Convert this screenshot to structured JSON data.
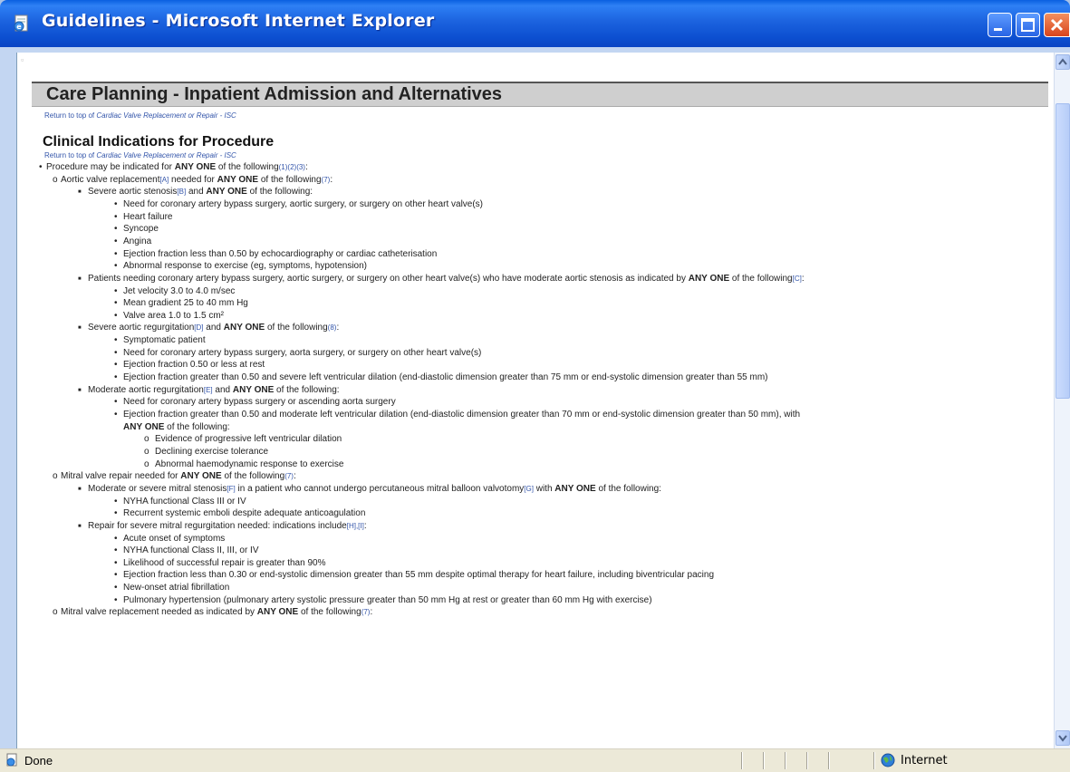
{
  "window": {
    "title": "Guidelines - Microsoft Internet Explorer"
  },
  "page": {
    "header_title": "Care Planning - Inpatient Admission and Alternatives",
    "return_link_1": {
      "prefix": "Return to top of ",
      "target": "Cardiac Valve Replacement or Repair - ISC"
    },
    "section_title": "Clinical Indications for Procedure",
    "return_link_2": {
      "prefix": "Return to top of ",
      "target": "Cardiac Valve Replacement or Repair - ISC"
    }
  },
  "content_lines": [
    {
      "level": 1,
      "parts": [
        {
          "t": "Procedure may be indicated for "
        },
        {
          "t": "ANY ONE",
          "b": true
        },
        {
          "t": " of the following"
        },
        {
          "t": "(1)(2)(3)",
          "r": true
        },
        {
          "t": ":"
        }
      ]
    },
    {
      "level": 2,
      "parts": [
        {
          "t": "Aortic valve replacement"
        },
        {
          "t": "[A]",
          "r": true
        },
        {
          "t": " needed for "
        },
        {
          "t": "ANY ONE",
          "b": true
        },
        {
          "t": " of the following"
        },
        {
          "t": "(7)",
          "r": true
        },
        {
          "t": ":"
        }
      ]
    },
    {
      "level": 3,
      "parts": [
        {
          "t": "Severe aortic stenosis"
        },
        {
          "t": "[B]",
          "r": true
        },
        {
          "t": " and "
        },
        {
          "t": "ANY ONE",
          "b": true
        },
        {
          "t": " of the following:"
        }
      ]
    },
    {
      "level": 4,
      "parts": [
        {
          "t": "Need for coronary artery bypass surgery, aortic surgery, or surgery on other heart valve(s)"
        }
      ]
    },
    {
      "level": 4,
      "parts": [
        {
          "t": "Heart failure"
        }
      ]
    },
    {
      "level": 4,
      "parts": [
        {
          "t": "Syncope"
        }
      ]
    },
    {
      "level": 4,
      "parts": [
        {
          "t": "Angina"
        }
      ]
    },
    {
      "level": 4,
      "parts": [
        {
          "t": "Ejection fraction less than 0.50 by echocardiography or cardiac catheterisation"
        }
      ]
    },
    {
      "level": 4,
      "parts": [
        {
          "t": "Abnormal response to exercise (eg, symptoms, hypotension)"
        }
      ]
    },
    {
      "level": 3,
      "parts": [
        {
          "t": "Patients needing coronary artery bypass surgery, aortic surgery, or surgery on other heart valve(s) who have moderate aortic stenosis as indicated by "
        },
        {
          "t": "ANY ONE",
          "b": true
        },
        {
          "t": " of the following"
        },
        {
          "t": "[C]",
          "r": true
        },
        {
          "t": ":"
        }
      ]
    },
    {
      "level": 4,
      "parts": [
        {
          "t": "Jet velocity 3.0 to 4.0 m/sec"
        }
      ]
    },
    {
      "level": 4,
      "parts": [
        {
          "t": "Mean gradient 25 to 40 mm Hg"
        }
      ]
    },
    {
      "level": 4,
      "parts": [
        {
          "t": "Valve area 1.0 to 1.5 cm²"
        }
      ]
    },
    {
      "level": 3,
      "parts": [
        {
          "t": "Severe aortic regurgitation"
        },
        {
          "t": "[D]",
          "r": true
        },
        {
          "t": " and "
        },
        {
          "t": "ANY ONE",
          "b": true
        },
        {
          "t": " of the following"
        },
        {
          "t": "(8)",
          "r": true
        },
        {
          "t": ":"
        }
      ]
    },
    {
      "level": 4,
      "parts": [
        {
          "t": "Symptomatic patient"
        }
      ]
    },
    {
      "level": 4,
      "parts": [
        {
          "t": "Need for coronary artery bypass surgery, aorta surgery, or surgery on other heart valve(s)"
        }
      ]
    },
    {
      "level": 4,
      "parts": [
        {
          "t": "Ejection fraction 0.50 or less at rest"
        }
      ]
    },
    {
      "level": 4,
      "parts": [
        {
          "t": "Ejection fraction greater than 0.50 and severe left ventricular dilation (end-diastolic dimension greater than 75 mm or end-systolic dimension greater than 55 mm)"
        }
      ]
    },
    {
      "level": 3,
      "parts": [
        {
          "t": "Moderate aortic regurgitation"
        },
        {
          "t": "[E]",
          "r": true
        },
        {
          "t": " and "
        },
        {
          "t": "ANY ONE",
          "b": true
        },
        {
          "t": " of the following:"
        }
      ]
    },
    {
      "level": 4,
      "parts": [
        {
          "t": "Need for coronary artery bypass surgery or ascending aorta surgery"
        }
      ]
    },
    {
      "level": 4,
      "parts": [
        {
          "t": "Ejection fraction greater than 0.50 and moderate left ventricular dilation (end-diastolic dimension greater than 70 mm or end-systolic dimension greater than 50 mm), with"
        }
      ]
    },
    {
      "level": 4,
      "cont": true,
      "parts": [
        {
          "t": "ANY ONE",
          "b": true
        },
        {
          "t": " of the following:"
        }
      ]
    },
    {
      "level": 5,
      "parts": [
        {
          "t": "Evidence of progressive left ventricular dilation"
        }
      ]
    },
    {
      "level": 5,
      "parts": [
        {
          "t": "Declining exercise tolerance"
        }
      ]
    },
    {
      "level": 5,
      "parts": [
        {
          "t": "Abnormal haemodynamic response to exercise"
        }
      ]
    },
    {
      "level": 2,
      "parts": [
        {
          "t": "Mitral valve repair needed for "
        },
        {
          "t": "ANY ONE",
          "b": true
        },
        {
          "t": " of the following"
        },
        {
          "t": "(7)",
          "r": true
        },
        {
          "t": ":"
        }
      ]
    },
    {
      "level": 3,
      "parts": [
        {
          "t": "Moderate or severe mitral stenosis"
        },
        {
          "t": "[F]",
          "r": true
        },
        {
          "t": " in a patient who cannot undergo percutaneous mitral balloon valvotomy"
        },
        {
          "t": "[G]",
          "r": true
        },
        {
          "t": " with "
        },
        {
          "t": "ANY ONE",
          "b": true
        },
        {
          "t": " of the following:"
        }
      ]
    },
    {
      "level": 4,
      "parts": [
        {
          "t": "NYHA functional Class III or IV"
        }
      ]
    },
    {
      "level": 4,
      "parts": [
        {
          "t": "Recurrent systemic emboli despite adequate anticoagulation"
        }
      ]
    },
    {
      "level": 3,
      "parts": [
        {
          "t": "Repair for severe mitral regurgitation needed: indications include"
        },
        {
          "t": "[H],[I]",
          "r": true
        },
        {
          "t": ":"
        }
      ]
    },
    {
      "level": 4,
      "parts": [
        {
          "t": "Acute onset of symptoms"
        }
      ]
    },
    {
      "level": 4,
      "parts": [
        {
          "t": "NYHA functional Class II, III, or IV"
        }
      ]
    },
    {
      "level": 4,
      "parts": [
        {
          "t": "Likelihood of successful repair is greater than 90%"
        }
      ]
    },
    {
      "level": 4,
      "parts": [
        {
          "t": "Ejection fraction less than 0.30 or end-systolic dimension greater than 55 mm despite optimal therapy for heart failure, including biventricular pacing"
        }
      ]
    },
    {
      "level": 4,
      "parts": [
        {
          "t": "New-onset atrial fibrillation"
        }
      ]
    },
    {
      "level": 4,
      "parts": [
        {
          "t": "Pulmonary hypertension (pulmonary artery systolic pressure greater than 50 mm Hg at rest or greater than 60 mm Hg with exercise)"
        }
      ]
    },
    {
      "level": 2,
      "parts": [
        {
          "t": "Mitral valve replacement needed as indicated by "
        },
        {
          "t": "ANY ONE",
          "b": true
        },
        {
          "t": " of the following"
        },
        {
          "t": "(7)",
          "r": true
        },
        {
          "t": ":"
        }
      ]
    }
  ],
  "statusbar": {
    "status": "Done",
    "zone": "Internet"
  },
  "icons": {
    "app": "ie-page-icon",
    "status": "page-done-icon",
    "zone": "globe-icon"
  },
  "colors": {
    "titlebar": "#1c63df",
    "link": "#3355aa",
    "header_bar": "#cfcfcf"
  }
}
